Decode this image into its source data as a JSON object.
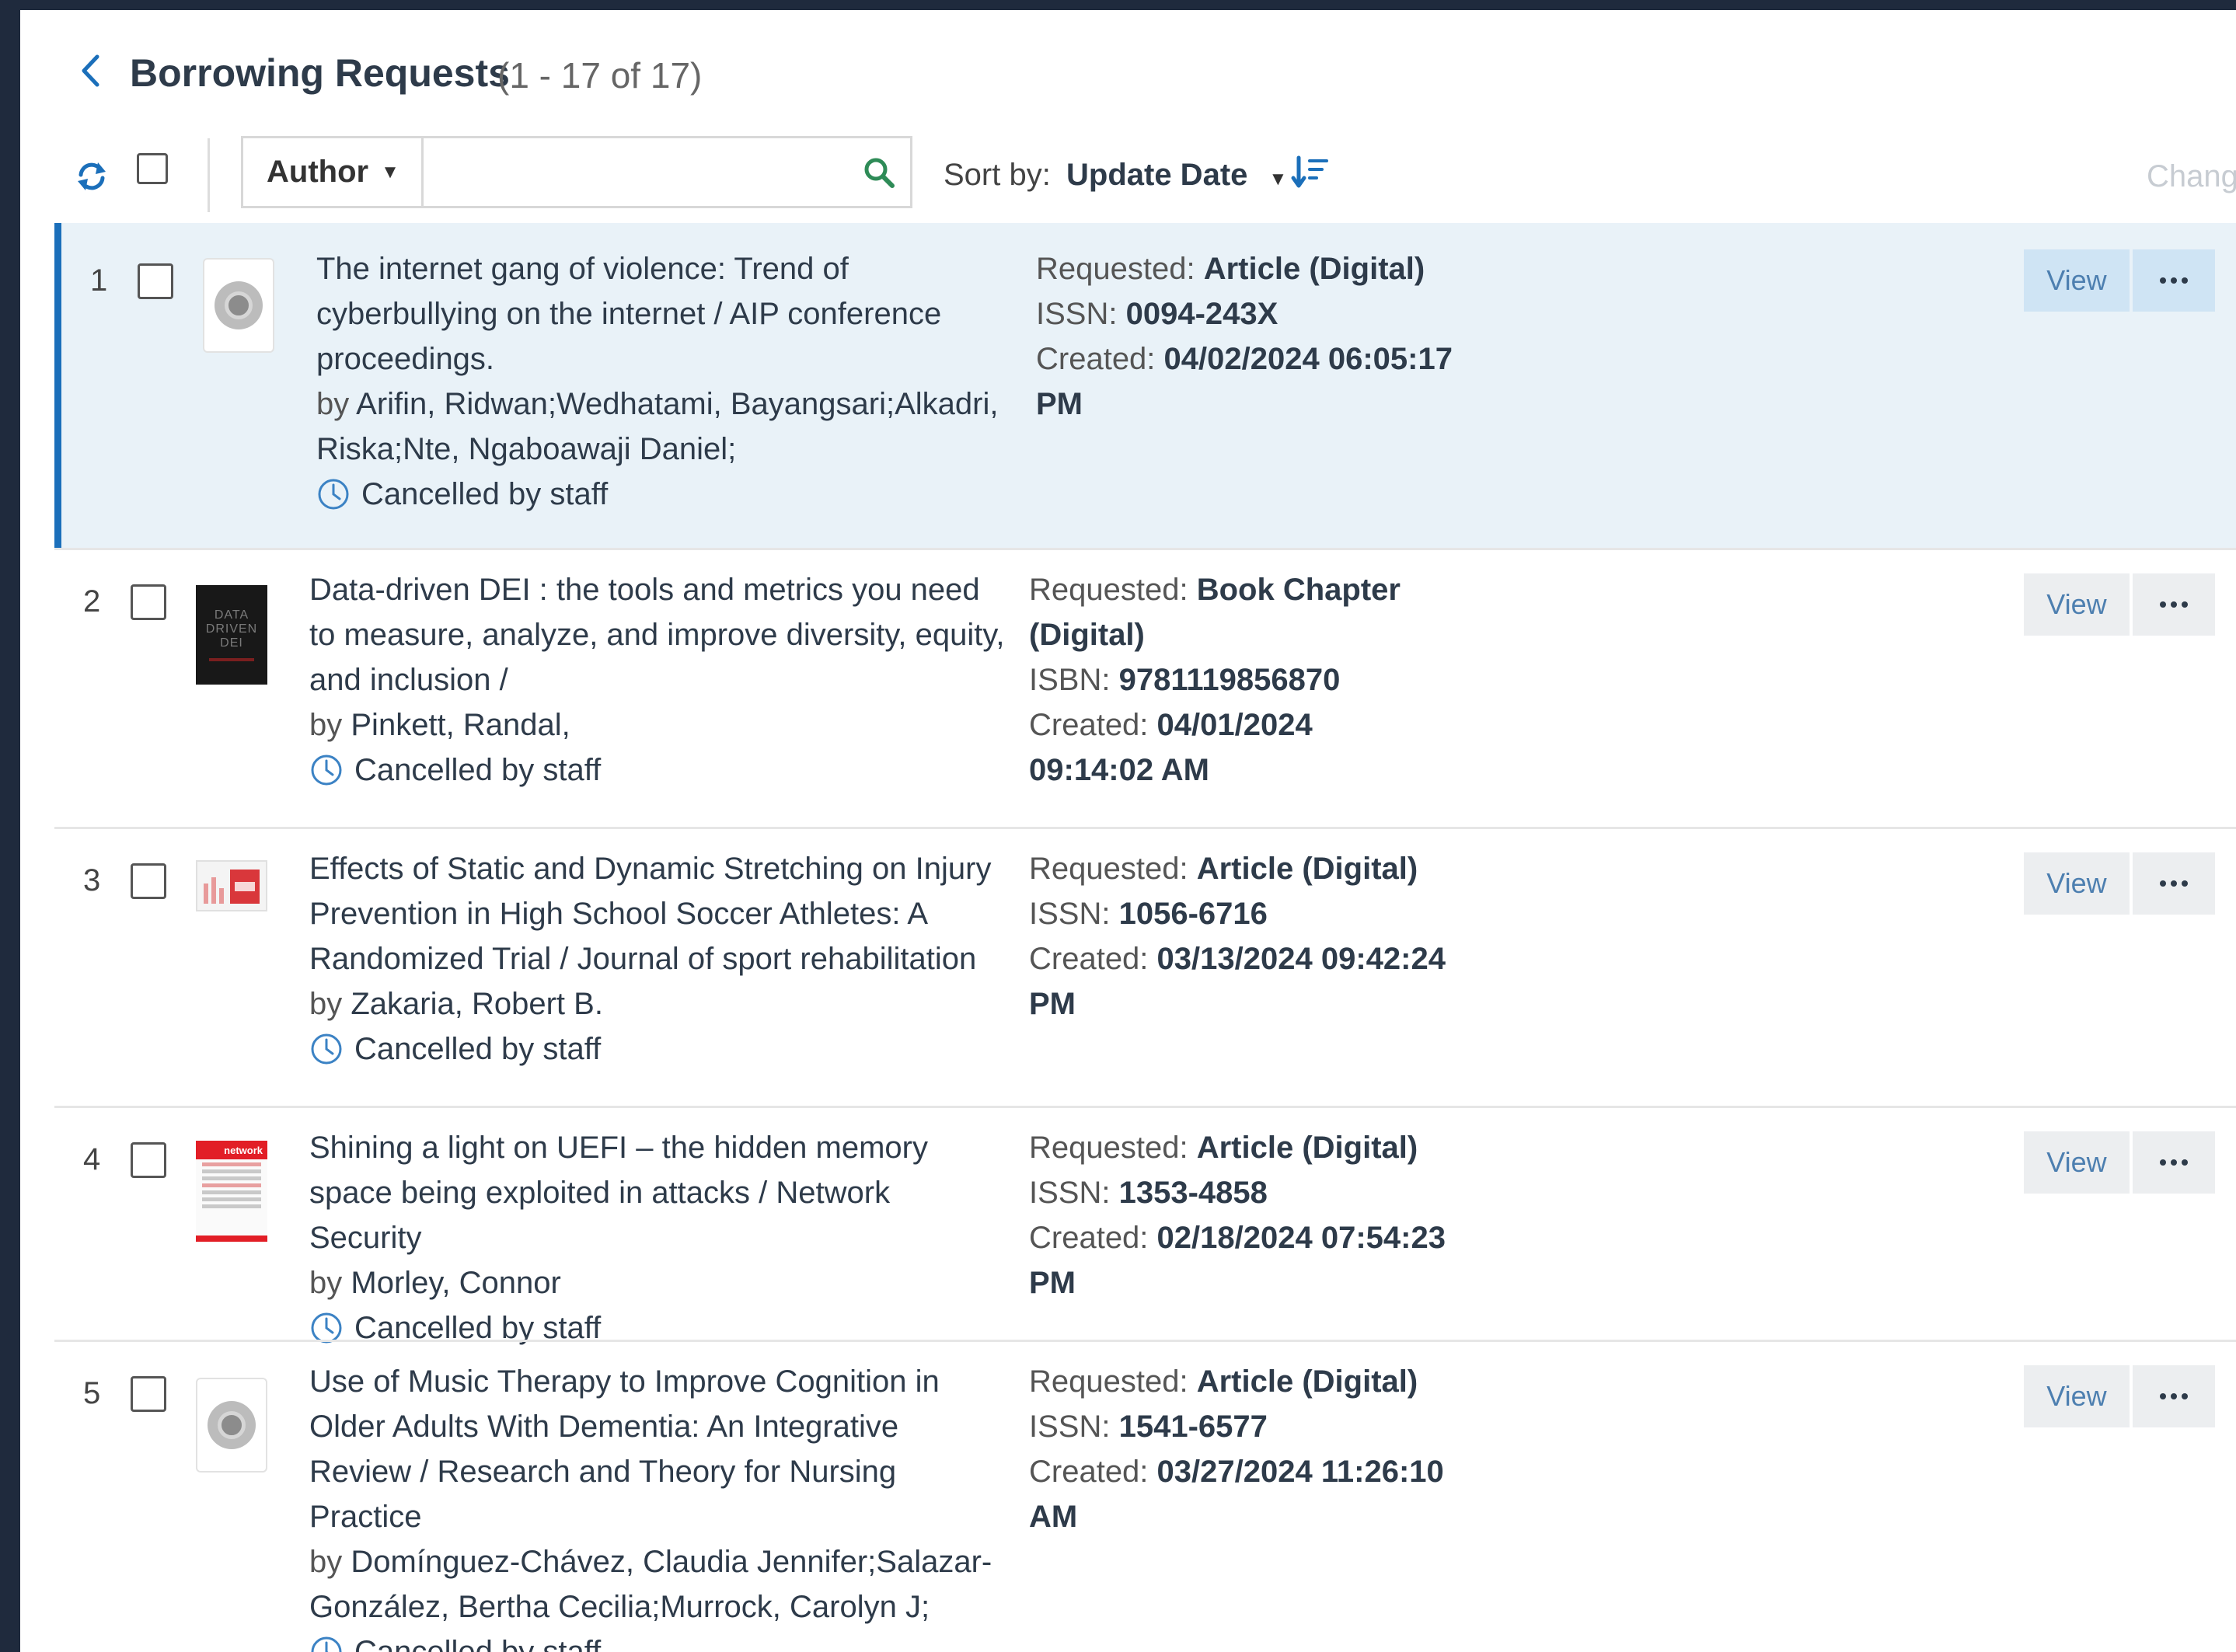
{
  "header": {
    "title": "Borrowing Requests",
    "count": "(1 - 17 of 17)"
  },
  "toolbar": {
    "search_field": "Author",
    "search_value": "",
    "sort_label": "Sort by:",
    "sort_value": "Update Date",
    "change_label": "Chang"
  },
  "icons": {
    "back": "chevron-left-icon",
    "refresh": "refresh-icon",
    "search": "search-icon",
    "sort_order": "sort-descending-icon",
    "status": "clock-icon",
    "more": "ellipsis-icon"
  },
  "colors": {
    "accent": "#1b6fba",
    "selected_row": "#e9f2f8",
    "link_blue": "#4d7fb0",
    "icon_blue": "#3b82c4",
    "search_icon": "#2e8b57",
    "frame_bg": "#1f2a3d"
  },
  "list": {
    "view_label": "View",
    "by_prefix": "by",
    "requested_label": "Requested:",
    "created_label": "Created:",
    "items": [
      {
        "index": "1",
        "title": "The internet gang of violence: Trend of cyberbullying on the internet / AIP conference proceedings.",
        "authors": "Arifin, Ridwan;Wedhatami, Bayangsari;Alkadri, Riska;Nte, Ngaboawaji Daniel;",
        "status": "Cancelled by staff",
        "requested": "Article (Digital)",
        "id_label": "ISSN:",
        "id_value": "0094-243X",
        "created": "04/02/2024 06:05:17 PM",
        "thumb": "placeholder",
        "selected": true
      },
      {
        "index": "2",
        "title": "Data-driven DEI : the tools and metrics you need to measure, analyze, and improve diversity, equity, and inclusion /",
        "authors": "Pinkett, Randal,",
        "status": "Cancelled by staff",
        "requested": "Book Chapter (Digital)",
        "id_label": "ISBN:",
        "id_value": "9781119856870",
        "created": "04/01/2024 09:14:02 AM",
        "thumb": "book-cover",
        "cover_text": [
          "DATA",
          "DRIVEN",
          "DEI"
        ],
        "selected": false
      },
      {
        "index": "3",
        "title": "Effects of Static and Dynamic Stretching on Injury Prevention in High School Soccer Athletes: A Randomized Trial / Journal of sport rehabilitation",
        "authors": "Zakaria, Robert B.",
        "status": "Cancelled by staff",
        "requested": "Article (Digital)",
        "id_label": "ISSN:",
        "id_value": "1056-6716",
        "created": "03/13/2024 09:42:24 PM",
        "thumb": "journal-thumb",
        "selected": false
      },
      {
        "index": "4",
        "title": "Shining a light on UEFI – the hidden memory space being exploited in attacks / Network Security",
        "authors": "Morley, Connor",
        "status": "Cancelled by staff",
        "requested": "Article (Digital)",
        "id_label": "ISSN:",
        "id_value": "1353-4858",
        "created": "02/18/2024 07:54:23 PM",
        "thumb": "magazine-cover",
        "cover_brand": "network",
        "selected": false
      },
      {
        "index": "5",
        "title": "Use of Music Therapy to Improve Cognition in Older Adults With Dementia: An Integrative Review / Research and Theory for Nursing Practice",
        "authors": "Domínguez-Chávez, Claudia Jennifer;Salazar-González, Bertha Cecilia;Murrock, Carolyn J;",
        "status": "Cancelled by staff",
        "requested": "Article (Digital)",
        "id_label": "ISSN:",
        "id_value": "1541-6577",
        "created": "03/27/2024 11:26:10 AM",
        "thumb": "placeholder",
        "selected": false
      }
    ]
  }
}
